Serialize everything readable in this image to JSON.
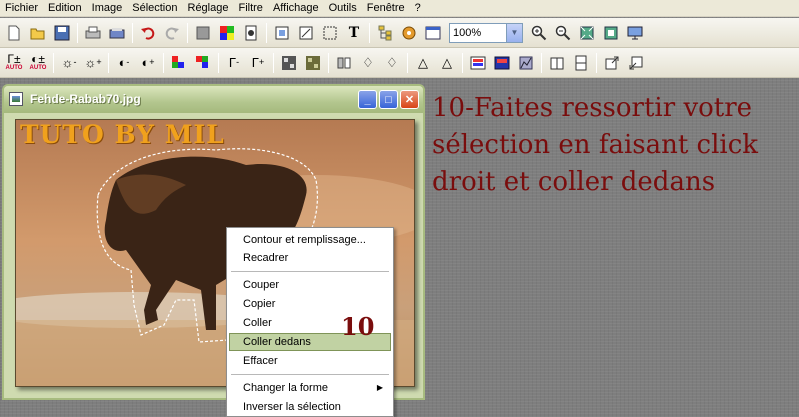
{
  "menu": [
    "Fichier",
    "Edition",
    "Image",
    "Sélection",
    "Réglage",
    "Filtre",
    "Affichage",
    "Outils",
    "Fenêtre",
    "?"
  ],
  "toolbar": {
    "zoom_value": "100%",
    "auto_label": "AUTO",
    "text_tool_glyph": "T"
  },
  "icons": {
    "toolbar1": [
      "new-icon",
      "open-icon",
      "save-icon",
      "print-icon",
      "scan-icon",
      "undo-icon",
      "redo-icon",
      "gray-square-icon",
      "color-grid-icon",
      "film-icon",
      "crop-icon",
      "resize-icon",
      "select-area-icon",
      "text-icon",
      "tree-icon",
      "plugin-icon",
      "window-icon",
      "zoom-in-icon",
      "zoom-out-icon",
      "fit-icon",
      "full-icon",
      "screen-icon"
    ],
    "toolbar2": [
      "gamma-auto-icon",
      "contrast-auto-icon",
      "sun-minus-icon",
      "sun-plus-icon",
      "halfmoon-minus-icon",
      "halfmoon-plus-icon",
      "rgb-minus-icon",
      "rgb-plus-icon",
      "gamma-minus-icon",
      "gamma-plus-icon",
      "grid-a-icon",
      "grid-b-icon",
      "mirror-icon",
      "drop-a-icon",
      "drop-b-icon",
      "cone-a-icon",
      "cone-b-icon",
      "palette-icon",
      "channels-icon",
      "histogram-icon",
      "book-icon",
      "page-icon",
      "export-icon",
      "import-icon"
    ]
  },
  "window": {
    "title": "Fehde-Rabab70.jpg",
    "watermark": "TUTO BY MIL",
    "min_glyph": "_",
    "max_glyph": "□",
    "close_glyph": "✕"
  },
  "instruction": {
    "line1": "10-Faites ressortir votre",
    "line2": "sélection en faisant click",
    "line3": "droit et coller dedans"
  },
  "context_menu": {
    "items": [
      "Contour et remplissage...",
      "Recadrer",
      "Couper",
      "Copier",
      "Coller",
      "Coller dedans",
      "Effacer",
      "Changer la forme",
      "Inverser la sélection"
    ],
    "highlighted": "Coller dedans",
    "submenu_arrow": "▶"
  },
  "step_number": "10",
  "colors": {
    "instruction_text": "#7a0d0d",
    "highlight": "#c1d2a3",
    "watermark": "#f0a11d"
  }
}
